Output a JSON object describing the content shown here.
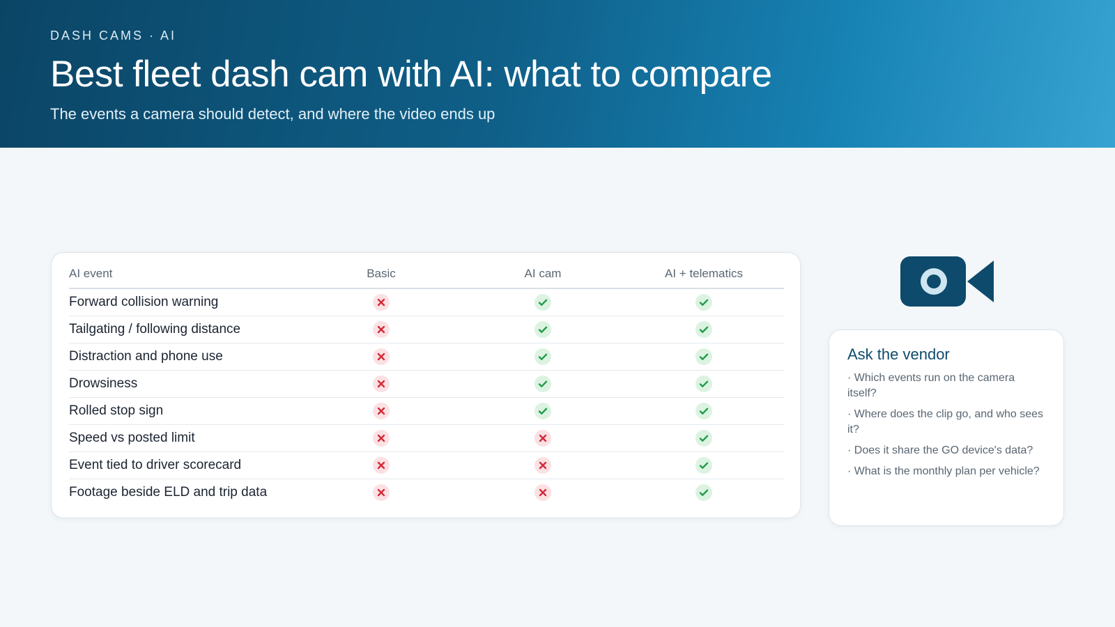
{
  "header": {
    "eyebrow": "DASH CAMS · AI",
    "title": "Best fleet dash cam with AI: what to compare",
    "subtitle": "The events a camera should detect, and where the video ends up"
  },
  "table": {
    "columns": [
      "AI event",
      "Basic",
      "AI cam",
      "AI + telematics"
    ],
    "rows": [
      {
        "event": "Forward collision warning",
        "basic": false,
        "ai_cam": true,
        "ai_telematics": true
      },
      {
        "event": "Tailgating / following distance",
        "basic": false,
        "ai_cam": true,
        "ai_telematics": true
      },
      {
        "event": "Distraction and phone use",
        "basic": false,
        "ai_cam": true,
        "ai_telematics": true
      },
      {
        "event": "Drowsiness",
        "basic": false,
        "ai_cam": true,
        "ai_telematics": true
      },
      {
        "event": "Rolled stop sign",
        "basic": false,
        "ai_cam": true,
        "ai_telematics": true
      },
      {
        "event": "Speed vs posted limit",
        "basic": false,
        "ai_cam": false,
        "ai_telematics": true
      },
      {
        "event": "Event tied to driver scorecard",
        "basic": false,
        "ai_cam": false,
        "ai_telematics": true
      },
      {
        "event": "Footage beside ELD and trip data",
        "basic": false,
        "ai_cam": false,
        "ai_telematics": true
      }
    ]
  },
  "vendor": {
    "title": "Ask the vendor",
    "questions": [
      "· Which events run on the camera itself?",
      "· Where does the clip go, and who sees it?",
      "· Does it share the GO device's data?",
      "· What is the monthly plan per vehicle?"
    ]
  },
  "icons": {
    "camera": "video-camera-icon",
    "yes": "check-icon",
    "no": "cross-icon"
  },
  "colors": {
    "header_start": "#0b4566",
    "header_end": "#37a3d2",
    "camera": "#0e4a6b",
    "check": "#1f9a48",
    "check_bg": "#dcf3e2",
    "cross": "#d32a3a",
    "cross_bg": "#fbe1e3"
  }
}
